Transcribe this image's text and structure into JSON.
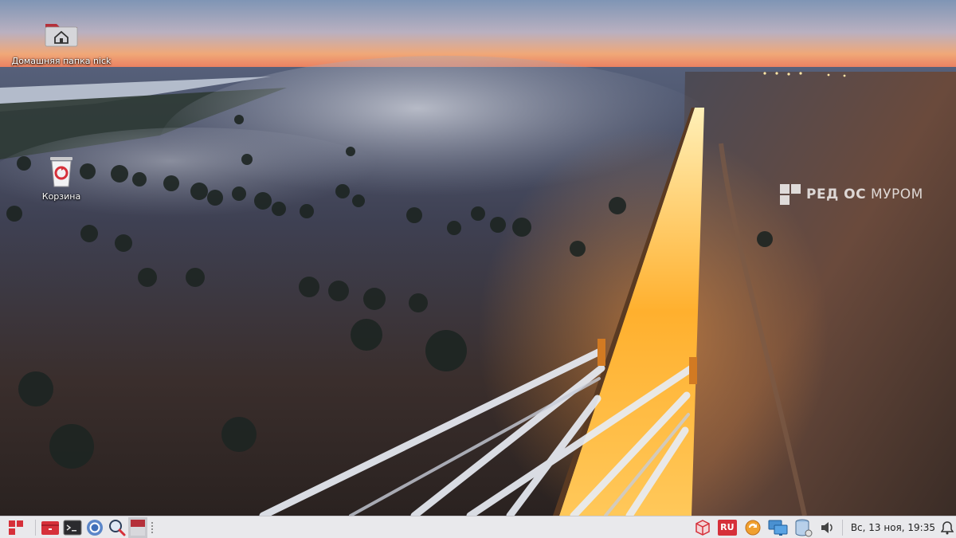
{
  "desktop": {
    "icons": [
      {
        "label": "Домашняя папка nick",
        "icon": "home-folder-icon"
      },
      {
        "label": "Корзина",
        "icon": "trash-icon"
      }
    ],
    "watermark": {
      "prefix": "РЕД ОС",
      "suffix": "МУРОМ"
    }
  },
  "taskbar": {
    "launchers": [
      {
        "name": "applications-menu",
        "icon": "redos-logo-icon"
      },
      {
        "name": "file-manager",
        "icon": "folder-icon"
      },
      {
        "name": "terminal",
        "icon": "terminal-icon"
      },
      {
        "name": "browser",
        "icon": "chromium-icon"
      },
      {
        "name": "search",
        "icon": "magnifier-icon"
      },
      {
        "name": "active-window",
        "icon": "window-icon"
      }
    ],
    "tray": {
      "keyboard_layout": "RU",
      "icons": [
        "package-update-icon",
        "keyboard-layout-icon",
        "update-manager-icon",
        "network-icon",
        "storage-icon",
        "volume-icon",
        "notifications-icon"
      ]
    },
    "clock": "Вс, 13 ноя, 19:35"
  },
  "colors": {
    "taskbar_bg": "#e9e9ec",
    "accent_red": "#d6303a",
    "bridge_light": "#ffb02e"
  }
}
